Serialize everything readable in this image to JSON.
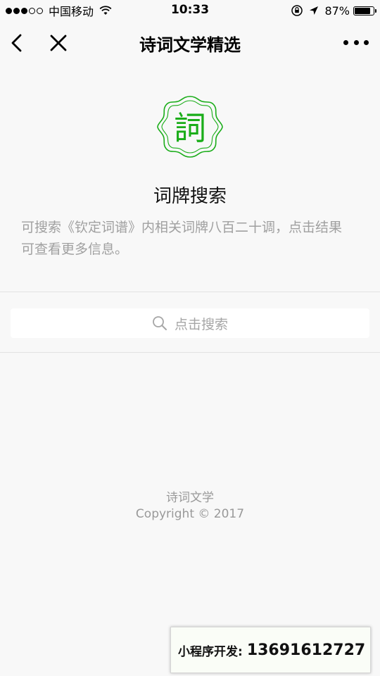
{
  "status_bar": {
    "carrier": "中国移动",
    "time": "10:33",
    "battery_percent": "87%",
    "battery_level": 0.87,
    "signal_dots_full": 3,
    "signal_dots_total": 5
  },
  "nav": {
    "title": "诗词文学精选",
    "back_icon": "chevron-left-icon",
    "close_icon": "close-icon",
    "more_icon": "more-icon"
  },
  "logo": {
    "char": "詞",
    "color": "#1aad19"
  },
  "page": {
    "title": "词牌搜索",
    "description": "可搜索《钦定词谱》内相关词牌八百二十调，点击结果可查看更多信息。"
  },
  "search": {
    "placeholder": "点击搜索",
    "icon": "search-icon"
  },
  "footer": {
    "title": "诗词文学",
    "copyright": "Copyright © 2017"
  },
  "ad": {
    "label": "小程序开发:",
    "number": "13691612727"
  }
}
